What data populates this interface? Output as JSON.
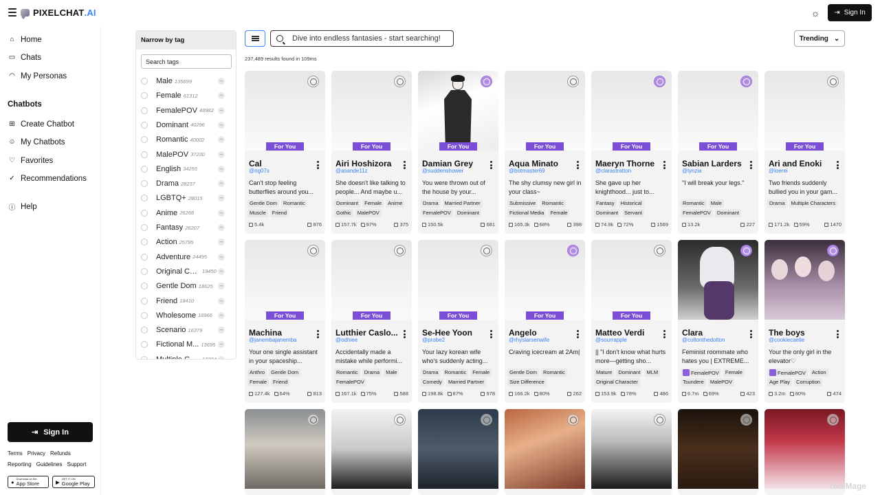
{
  "header": {
    "logo_main": "PIXELCHAT",
    "logo_suffix": ".AI",
    "signin_label": "Sign In"
  },
  "sidebar": {
    "nav": [
      {
        "label": "Home",
        "icon": "home-icon"
      },
      {
        "label": "Chats",
        "icon": "chat-icon"
      },
      {
        "label": "My Personas",
        "icon": "mask-icon"
      }
    ],
    "chatbots_title": "Chatbots",
    "chatbot_nav": [
      {
        "label": "Create Chatbot",
        "icon": "plus-square-icon"
      },
      {
        "label": "My Chatbots",
        "icon": "bot-icon"
      },
      {
        "label": "Favorites",
        "icon": "heart-icon"
      },
      {
        "label": "Recommendations",
        "icon": "check-circle-icon"
      }
    ],
    "help": "Help",
    "signin_label": "Sign In",
    "footer_row1": [
      "Terms",
      "Privacy",
      "Refunds"
    ],
    "footer_row2": [
      "Reporting",
      "Guidelines",
      "Support"
    ],
    "app_store": {
      "small": "Download on the",
      "big": "App Store"
    },
    "play_store": {
      "small": "GET IT ON",
      "big": "Google Play"
    }
  },
  "tags_panel": {
    "title": "Narrow by tag",
    "search_placeholder": "Search tags",
    "tags": [
      {
        "name": "Male",
        "count": "135699"
      },
      {
        "name": "Female",
        "count": "61312"
      },
      {
        "name": "FemalePOV",
        "count": "48982"
      },
      {
        "name": "Dominant",
        "count": "40296"
      },
      {
        "name": "Romantic",
        "count": "40002"
      },
      {
        "name": "MalePOV",
        "count": "37230"
      },
      {
        "name": "English",
        "count": "34255"
      },
      {
        "name": "Drama",
        "count": "28237"
      },
      {
        "name": "LGBTQ+",
        "count": "28015"
      },
      {
        "name": "Anime",
        "count": "26268"
      },
      {
        "name": "Fantasy",
        "count": "26207"
      },
      {
        "name": "Action",
        "count": "25795"
      },
      {
        "name": "Adventure",
        "count": "24495"
      },
      {
        "name": "Original Ch...",
        "count": "19450"
      },
      {
        "name": "Gentle Dom",
        "count": "18625"
      },
      {
        "name": "Friend",
        "count": "18410"
      },
      {
        "name": "Wholesome",
        "count": "16966"
      },
      {
        "name": "Scenario",
        "count": "16379"
      },
      {
        "name": "Fictional M...",
        "count": "13695"
      },
      {
        "name": "Multiple Ch...",
        "count": "13384"
      }
    ]
  },
  "search": {
    "placeholder": "Dive into endless fantasies - start searching!",
    "results_text": "237,489 results found in 109ms",
    "sort_label": "Trending"
  },
  "badge_label": "For You",
  "cards": [
    {
      "name": "Cal",
      "handle": "@ng07s",
      "desc": "Can't stop feeling butterflies around you...",
      "tags": [
        "Gentle Dom",
        "Romantic",
        "Muscle",
        "Friend"
      ],
      "chats": "5.4k",
      "likes": "",
      "count": "876",
      "pov": false,
      "purple_info": false
    },
    {
      "name": "Airi Hoshizora",
      "handle": "@asande11z",
      "desc": "She doesn't like talking to people... And maybe u...",
      "tags": [
        "Dominant",
        "Female",
        "Anime",
        "Gothic",
        "MalePOV"
      ],
      "chats": "157.7k",
      "likes": "97%",
      "count": "375",
      "pov": false,
      "purple_info": false
    },
    {
      "name": "Damian Grey",
      "handle": "@suddenshower",
      "desc": "You were thrown out of the house by your...",
      "tags": [
        "Drama",
        "Married Partner",
        "FemalePOV",
        "Dominant"
      ],
      "chats": "150.5k",
      "likes": "",
      "count": "681",
      "pov": false,
      "purple_info": true
    },
    {
      "name": "Aqua Minato",
      "handle": "@botmaster69",
      "desc": "The shy clumsy new girl in your class~",
      "tags": [
        "Submissive",
        "Romantic",
        "Fictional Media",
        "Female"
      ],
      "chats": "165.3k",
      "likes": "68%",
      "count": "398",
      "pov": false,
      "purple_info": false
    },
    {
      "name": "Maeryn Thorne",
      "handle": "@clarastratton",
      "desc": "She gave up her knighthood... just to...",
      "tags": [
        "Fantasy",
        "Historical",
        "Dominant",
        "Servant"
      ],
      "chats": "74.9k",
      "likes": "72%",
      "count": "1569",
      "pov": false,
      "purple_info": true
    },
    {
      "name": "Sabian Larders",
      "handle": "@lynzia",
      "desc": "\"I will break your legs.\"",
      "tags": [
        "Romantic",
        "Male",
        "FemalePOV",
        "Dominant"
      ],
      "chats": "13.2k",
      "likes": "",
      "count": "227",
      "pov": false,
      "purple_info": true
    },
    {
      "name": "Ari and Enoki",
      "handle": "@loerei",
      "desc": "Two friends suddenly bullied you in your gam...",
      "tags": [
        "Drama",
        "Multiple Characters"
      ],
      "chats": "171.2k",
      "likes": "59%",
      "count": "1470",
      "pov": false,
      "purple_info": false
    },
    {
      "name": "Machina",
      "handle": "@janembajanemba",
      "desc": "Your one single assistant in your spaceship...",
      "tags": [
        "Anthro",
        "Gentle Dom",
        "Female",
        "Friend"
      ],
      "chats": "127.4k",
      "likes": "64%",
      "count": "813",
      "pov": false,
      "purple_info": false
    },
    {
      "name": "Lutthier Caslo...",
      "handle": "@odhiee",
      "desc": "Accidentally made a mistake while performi...",
      "tags": [
        "Romantic",
        "Drama",
        "Male",
        "FemalePOV"
      ],
      "chats": "167.1k",
      "likes": "75%",
      "count": "588",
      "pov": false,
      "purple_info": false
    },
    {
      "name": "Se-Hee Yoon",
      "handle": "@probe2",
      "desc": "Your lazy korean wife who's suddenly acting...",
      "tags": [
        "Drama",
        "Romantic",
        "Female",
        "Comedy",
        "Married Partner"
      ],
      "chats": "198.8k",
      "likes": "87%",
      "count": "978",
      "pov": false,
      "purple_info": false
    },
    {
      "name": "Angelo",
      "handle": "@rhyslarsenwife",
      "desc": "Craving icecream at 2Am|",
      "tags": [
        "Gentle Dom",
        "Romantic",
        "Size Difference"
      ],
      "chats": "166.2k",
      "likes": "80%",
      "count": "262",
      "pov": false,
      "purple_info": true
    },
    {
      "name": "Matteo Verdi",
      "handle": "@sourrapple",
      "desc": "|| \"I don't know what hurts more—getting sho...",
      "tags": [
        "Mature",
        "Dominant",
        "MLM",
        "Original Character"
      ],
      "chats": "153.9k",
      "likes": "78%",
      "count": "486",
      "pov": false,
      "purple_info": false
    },
    {
      "name": "Clara",
      "handle": "@coltonthedolton",
      "desc": "Feminist roommate who hates you | EXTREME...",
      "tags": [
        "FemalePOV",
        "Female",
        "Tsundere",
        "MalePOV"
      ],
      "chats": "6.7m",
      "likes": "69%",
      "count": "423",
      "pov": true,
      "purple_info": true
    },
    {
      "name": "The boys",
      "handle": "@cookiecaelie",
      "desc": "Your the only girl in the elevator♡",
      "tags": [
        "FemalePOV",
        "Action",
        "Age Play",
        "Corruption"
      ],
      "chats": "3.2m",
      "likes": "80%",
      "count": "474",
      "pov": true,
      "purple_info": true
    }
  ],
  "watermark": "ToolMage"
}
